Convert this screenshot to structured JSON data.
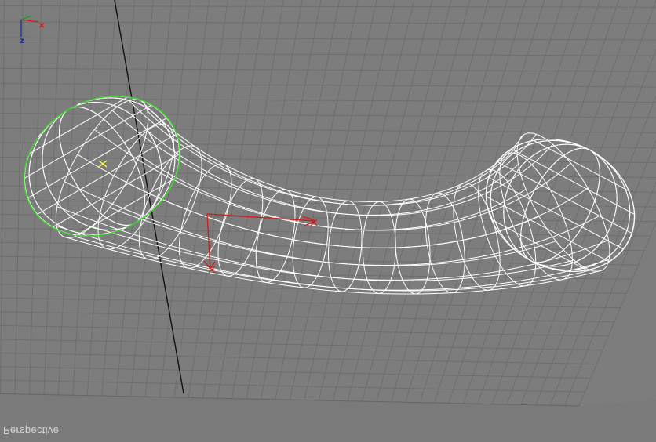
{
  "viewport": {
    "label": "Perspective",
    "background": "#7d7d7d",
    "grid_color": "#6e6e6e",
    "grid_axis_color": "#111111",
    "wireframe_color": "#ffffff",
    "selection_color": "#3fcf2e",
    "pivot_color": "#ffff40",
    "gizmo_color": "#cc2020"
  },
  "axis_tripod": {
    "x_label": "x",
    "z_label": "z",
    "x_color": "#d01818",
    "z_color": "#1a2aa0",
    "y_color": "#10a010"
  },
  "object": {
    "name": "curved-tube-wireframe",
    "selected_end": "left"
  }
}
